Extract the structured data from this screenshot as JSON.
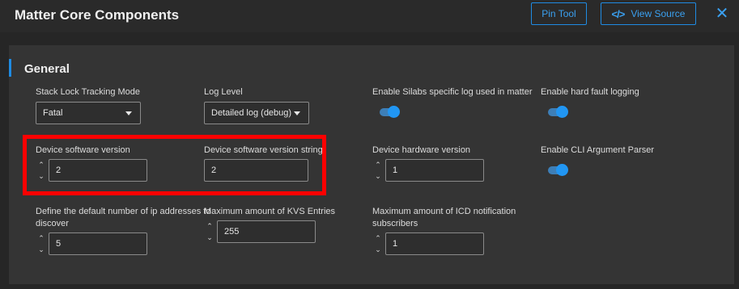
{
  "header": {
    "title": "Matter Core Components",
    "pin_tool_label": "Pin Tool",
    "view_source_label": "View Source",
    "close_icon": "close-icon"
  },
  "section": {
    "title": "General"
  },
  "fields": {
    "stack_lock": {
      "label": "Stack Lock Tracking Mode",
      "value": "Fatal"
    },
    "log_level": {
      "label": "Log Level",
      "value": "Detailed log (debug)"
    },
    "silabs_log": {
      "label": "Enable Silabs specific log used in matter",
      "on": true
    },
    "hard_fault": {
      "label": "Enable hard fault logging",
      "on": true
    },
    "sw_version": {
      "label": "Device software version",
      "value": "2"
    },
    "sw_version_string": {
      "label": "Device software version string",
      "value": "2"
    },
    "hw_version": {
      "label": "Device hardware version",
      "value": "1"
    },
    "cli_parser": {
      "label": "Enable CLI Argument Parser",
      "on": true
    },
    "ip_addresses": {
      "label_line1": "Define the default number of ip addresses to",
      "label_line2": "discover",
      "value": "5"
    },
    "kvs_entries": {
      "label": "Maximum amount of KVS Entries",
      "value": "255"
    },
    "icd_subscribers": {
      "label_line1": "Maximum amount of ICD notification",
      "label_line2": "subscribers",
      "value": "1"
    }
  },
  "colors": {
    "accent": "#1f8be3",
    "highlight": "#ff0000",
    "panel": "#343434",
    "background": "#262626"
  }
}
